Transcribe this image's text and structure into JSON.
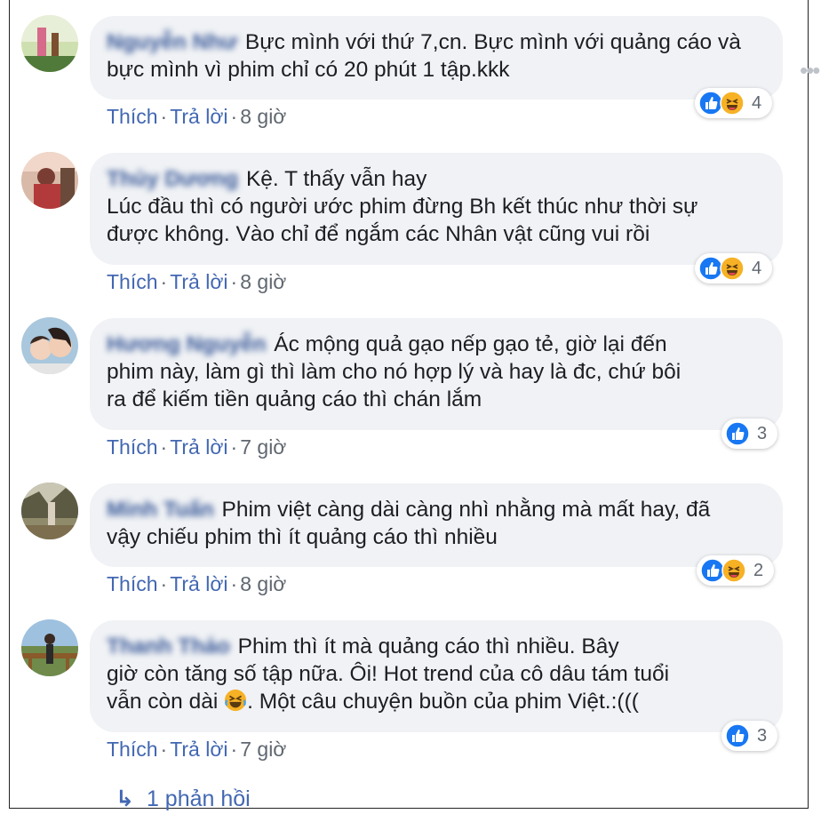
{
  "comments": [
    {
      "author": "Nguyễn Như",
      "text_line1": "Bực mình với thứ 7,cn. Bực mình với quảng cáo và",
      "text_line2": "bực mình vì phim chỉ có 20 phút 1 tập.kkk",
      "text_line3": "",
      "like_label": "Thích",
      "reply_label": "Trả lời",
      "time": "8 giờ",
      "reaction_count": "4",
      "reactions": [
        "like-icon",
        "haha-icon"
      ]
    },
    {
      "author": "Thủy Dương",
      "text_line1": "Kệ. T thấy vẫn hay",
      "text_line2": "Lúc đầu thì có người ước phim đừng Bh kết thúc như thời sự",
      "text_line3": "được không. Vào chỉ để ngắm các Nhân vật cũng vui rồi",
      "like_label": "Thích",
      "reply_label": "Trả lời",
      "time": "8 giờ",
      "reaction_count": "4",
      "reactions": [
        "like-icon",
        "haha-icon"
      ]
    },
    {
      "author": "Hương Nguyễn",
      "text_line1": "Ác mộng quả gạo nếp gạo tẻ, giờ lại đến",
      "text_line2": "phim này, làm gì thì làm cho nó hợp lý và hay là đc, chứ bôi",
      "text_line3": "ra để kiếm tiền quảng cáo thì chán lắm",
      "like_label": "Thích",
      "reply_label": "Trả lời",
      "time": "7 giờ",
      "reaction_count": "3",
      "reactions": [
        "like-icon"
      ]
    },
    {
      "author": "Minh Tuấn",
      "text_line1": "Phim việt càng dài càng nhì nhằng mà mất hay, đã",
      "text_line2": "vậy chiếu phim thì ít quảng cáo thì nhiều",
      "text_line3": "",
      "like_label": "Thích",
      "reply_label": "Trả lời",
      "time": "8 giờ",
      "reaction_count": "2",
      "reactions": [
        "like-icon",
        "haha-icon"
      ]
    },
    {
      "author": "Thanh Thảo",
      "text_line1": "Phim thì ít mà quảng cáo thì nhiều. Bây",
      "text_line2": "giờ còn tăng số tập nữa. Ôi! Hot trend của cô dâu tám tuổi",
      "text_line3_a": "vẫn còn dài",
      "text_line3_emoji": "🤣",
      "text_line3_b": ". Một câu chuyện buồn của phim Việt.:(((",
      "like_label": "Thích",
      "reply_label": "Trả lời",
      "time": "7 giờ",
      "reaction_count": "3",
      "reactions": [
        "like-icon"
      ]
    }
  ],
  "view_replies": {
    "arrow": "↳",
    "label": "1 phản hồi"
  },
  "more_icon": "more-options-icon",
  "colors": {
    "link": "#4267b2",
    "author": "#385898",
    "bubble": "#f0f2f5",
    "like_blue": "#1877f2",
    "haha_yellow": "#f7b125"
  }
}
